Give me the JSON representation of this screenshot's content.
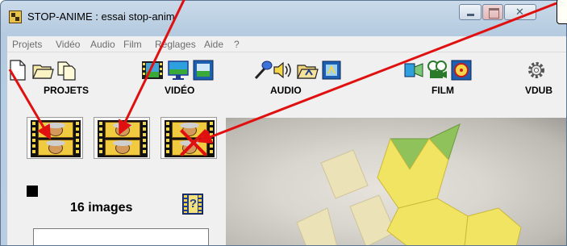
{
  "window": {
    "title": "STOP-ANIME : essai stop-anim"
  },
  "menu": {
    "items": [
      "Projets",
      "Vidéo",
      "Audio",
      "Film",
      "Réglages",
      "Aide",
      "?"
    ]
  },
  "toolbar": {
    "groups": [
      {
        "label": "PROJETS",
        "icons": [
          "new-document-icon",
          "open-folder-icon",
          "copy-documents-icon"
        ]
      },
      {
        "label": "VIDÉO",
        "icons": [
          "film-strip-icon",
          "monitor-icon",
          "camera-capture-icon"
        ]
      },
      {
        "label": "AUDIO",
        "icons": [
          "microphone-icon",
          "speaker-icon",
          "folder-sound-icon",
          "sound-film-icon"
        ]
      },
      {
        "label": "FILM",
        "icons": [
          "film-projector-icon",
          "film-reel-icon",
          "film-reel-settings-icon"
        ]
      },
      {
        "label": "VDUB",
        "icons": [
          "gear-icon"
        ]
      }
    ]
  },
  "left_panel": {
    "film_buttons": [
      "film-strip-icon",
      "film-strip-add-icon",
      "film-strip-delete-icon"
    ],
    "images_count": "16 images",
    "help_symbol": "?"
  },
  "colors": {
    "arrow": "#e01010",
    "film_frame": "#f1cb3f",
    "preview_background": "#d9d5cf",
    "tile_yellow": "#f2e463",
    "tile_green": "#8fc25a"
  }
}
